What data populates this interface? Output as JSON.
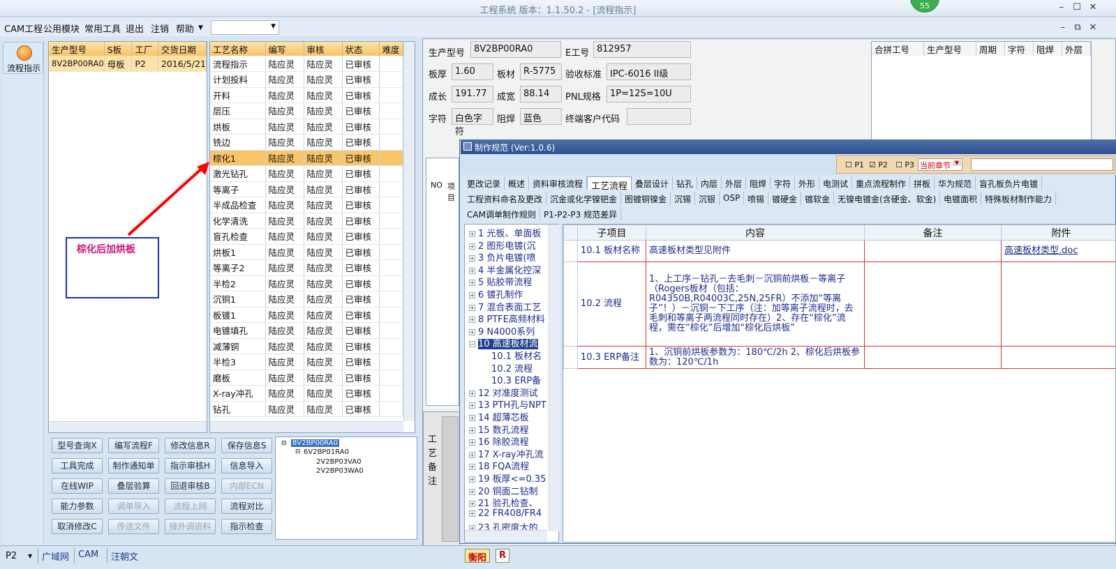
{
  "window": {
    "title": "工程系统 版本：1.1.50.2 - [流程指示]",
    "badge": "55"
  },
  "menu": [
    "CAM工程",
    "公用模块",
    "常用工具",
    "退出",
    "注销",
    "帮助"
  ],
  "left_nav": {
    "label": "流程指示"
  },
  "order_grid": {
    "headers": [
      "生产型号",
      "S板",
      "工厂",
      "交货日期"
    ],
    "row": [
      "8V2BP00RA0",
      "母板",
      "P2",
      "2016/5/21"
    ]
  },
  "process_grid": {
    "headers": [
      "工艺名称",
      "编写",
      "审核",
      "状态",
      "难度"
    ],
    "rows": [
      [
        "流程指示",
        "陆应灵",
        "陆应灵",
        "已审核"
      ],
      [
        "计划投料",
        "陆应灵",
        "陆应灵",
        "已审核"
      ],
      [
        "开料",
        "陆应灵",
        "陆应灵",
        "已审核"
      ],
      [
        "层压",
        "陆应灵",
        "陆应灵",
        "已审核"
      ],
      [
        "烘板",
        "陆应灵",
        "陆应灵",
        "已审核"
      ],
      [
        "铣边",
        "陆应灵",
        "陆应灵",
        "已审核"
      ],
      [
        "棕化1",
        "陆应灵",
        "陆应灵",
        "已审核"
      ],
      [
        "激光钻孔",
        "陆应灵",
        "陆应灵",
        "已审核"
      ],
      [
        "等离子",
        "陆应灵",
        "陆应灵",
        "已审核"
      ],
      [
        "半成品检查",
        "陆应灵",
        "陆应灵",
        "已审核"
      ],
      [
        "化学清洗",
        "陆应灵",
        "陆应灵",
        "已审核"
      ],
      [
        "盲孔检查",
        "陆应灵",
        "陆应灵",
        "已审核"
      ],
      [
        "烘板1",
        "陆应灵",
        "陆应灵",
        "已审核"
      ],
      [
        "等离子2",
        "陆应灵",
        "陆应灵",
        "已审核"
      ],
      [
        "半检2",
        "陆应灵",
        "陆应灵",
        "已审核"
      ],
      [
        "沉铜1",
        "陆应灵",
        "陆应灵",
        "已审核"
      ],
      [
        "板镀1",
        "陆应灵",
        "陆应灵",
        "已审核"
      ],
      [
        "电镀填孔",
        "陆应灵",
        "陆应灵",
        "已审核"
      ],
      [
        "减薄铜",
        "陆应灵",
        "陆应灵",
        "已审核"
      ],
      [
        "半检3",
        "陆应灵",
        "陆应灵",
        "已审核"
      ],
      [
        "磨板",
        "陆应灵",
        "陆应灵",
        "已审核"
      ],
      [
        "X-ray冲孔",
        "陆应灵",
        "陆应灵",
        "已审核"
      ],
      [
        "钻孔",
        "陆应灵",
        "陆应灵",
        "已审核"
      ]
    ]
  },
  "annotation": {
    "text": "棕化后加烘板"
  },
  "buttons": [
    [
      "型号查询X",
      "编写流程F",
      "修改信息R",
      "保存信息S"
    ],
    [
      "工具完成",
      "制作通知单",
      "指示审核H",
      "信息导入"
    ],
    [
      "在线WIP",
      "叠层验算",
      "回退审核B",
      "内部ECN"
    ],
    [
      "能力参数",
      "调单导入",
      "流程上网",
      "流程对比"
    ],
    [
      "取消修改C",
      "传送文件",
      "接外调资料",
      "指示检查"
    ]
  ],
  "disabled_buttons": [
    "内部ECN",
    "调单导入",
    "流程上网",
    "传送文件",
    "接外调资料"
  ],
  "tree_left": [
    "8V2BP00RA0",
    "6V2BP01RA0",
    "2V2BP03VA0",
    "2V2BP03WA0"
  ],
  "info": {
    "labels": {
      "model": "生产型号",
      "e": "E工号",
      "thick": "板厚",
      "mat": "板材",
      "std": "验收标准",
      "len": "成长",
      "wid": "成宽",
      "pnl": "PNL规格",
      "char": "字符",
      "mask": "阻焊",
      "cust": "终端客户代码"
    },
    "values": {
      "model": "8V2BP00RA0",
      "e": "812957",
      "thick": "1.60",
      "mat": "R-5775",
      "std": "IPC-6016 II级",
      "len": "191.77",
      "wid": "88.14",
      "pnl": "1P=12S=10U",
      "char": "白色字符",
      "mask": "蓝色",
      "cust": ""
    }
  },
  "right_grid": {
    "headers": [
      "合拼工号",
      "生产型号",
      "周期",
      "字符",
      "阻焊",
      "外层"
    ]
  },
  "mid_grid": {
    "headers": [
      "NO",
      "项目"
    ]
  },
  "side_note": "工艺备注",
  "dialog": {
    "title": "制作规范 (Ver:1.0.6)",
    "checks": [
      "P1",
      "P2",
      "P3"
    ],
    "chapter": "当前章节",
    "tabs1": [
      "更改记录",
      "概述",
      "资料审核流程",
      "工艺流程",
      "叠层设计",
      "钻孔",
      "内层",
      "外层",
      "阻焊",
      "字符",
      "外形",
      "电测试",
      "重点流程制作",
      "拼板",
      "华为规范",
      "盲孔板负片电镀"
    ],
    "tabs2": [
      "工程资料命名及更改",
      "沉金或化学镍钯金",
      "图镀铜镍金",
      "沉锡",
      "沉银",
      "OSP",
      "喷锡",
      "镀硬金",
      "镀软金",
      "无镍电镀金(含硬金、软金)",
      "电镀面积",
      "特殊板材制作能力"
    ],
    "tabs3": [
      "CAM调单制作规则",
      "P1-P2-P3 规范差异"
    ],
    "tree": [
      "1 光板、单面板",
      "2 图形电镀(沉",
      "3 负片电镀(喷",
      "4 半金属化控深",
      "5 贴胶带流程",
      "6 镀孔制作",
      "7 混合表面工艺",
      "8 PTFE高频材料",
      "9 N4000系列",
      "10 高速板材流",
      "10.1 板材名",
      "10.2 流程",
      "10.3 ERP备",
      "12 对准度测试",
      "13 PTH孔与NPT",
      "14 超薄芯板",
      "15 数孔流程",
      "16 除胶流程",
      "17 X-ray冲孔流",
      "18 FQA流程",
      "19 板厚<=0.35",
      "20 铜面二钻制",
      "21 验孔检查、",
      "22 FR408/FR4",
      "23 孔密度大的"
    ],
    "spec_headers": [
      "子项目",
      "内容",
      "备注",
      "附件"
    ],
    "spec_rows": [
      {
        "item": "10.1 板材名称",
        "content": "高速板材类型见附件",
        "note": "",
        "attach": "高速板材类型.doc"
      },
      {
        "item": "10.2 流程",
        "content": "1、上工序－钻孔－去毛刺－沉铜前烘板－等离子（Rogers板材（包括：R04350B,R04003C,25N,25FR）不添加“等离子”！）－沉铜－下工序（注：加等离子流程时，去毛刺和等离子两流程同时存在）2、存在“棕化”流程，需在“棕化”后增加“棕化后烘板”",
        "note": "",
        "attach": ""
      },
      {
        "item": "10.3 ERP备注",
        "content": "1、沉铜前烘板参数为：180℃/2h 2、棕化后烘板参数为：120℃/1h",
        "note": "",
        "attach": ""
      }
    ]
  },
  "status": [
    "P2",
    "广域网",
    "CAM",
    "汪朝文"
  ],
  "taskbar": [
    "衡阳",
    "R"
  ],
  "colors": {
    "selected_row": "#f9c56a",
    "header": "#f7c36a",
    "annotation": "#d0107a",
    "annotation_border": "#1a2fb8",
    "arrow": "#ff0000"
  }
}
